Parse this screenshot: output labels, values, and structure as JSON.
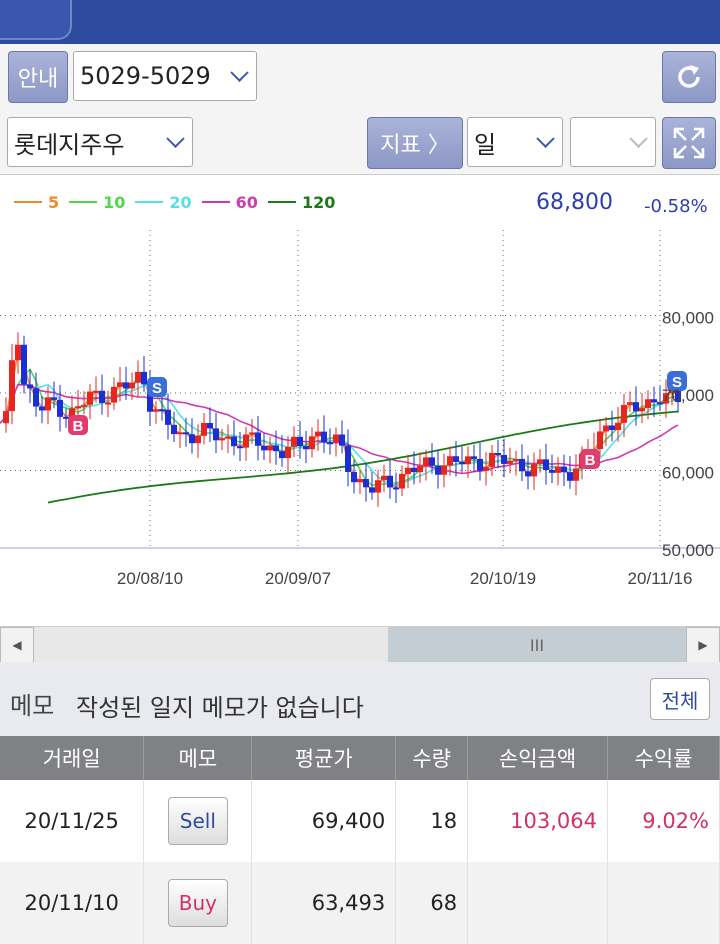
{
  "toolbar": {
    "guide_label": "안내",
    "account_value": "5029-5029",
    "stock_value": "롯데지주우",
    "indicator_label": "지표 〉",
    "period_value": "일",
    "extra_value": ""
  },
  "chart_header": {
    "legend": [
      {
        "label": "5",
        "color": "#ef8a2a"
      },
      {
        "label": "10",
        "color": "#4fd84a"
      },
      {
        "label": "20",
        "color": "#55e0e8"
      },
      {
        "label": "60",
        "color": "#d03ab0"
      },
      {
        "label": "120",
        "color": "#1c7a18"
      }
    ],
    "price": "68,800",
    "change": "-0.58%"
  },
  "chart_data": {
    "type": "candlestick",
    "x_tick_labels": [
      "20/08/10",
      "20/09/07",
      "20/10/19",
      "20/11/16"
    ],
    "y_tick_labels": [
      "80,000",
      "70,000",
      "60,000",
      "50,000"
    ],
    "ylim": [
      50000,
      90000
    ],
    "series": [
      {
        "name": "5",
        "color": "#ef8a2a"
      },
      {
        "name": "10",
        "color": "#4fd84a"
      },
      {
        "name": "20",
        "color": "#55e0e8"
      },
      {
        "name": "60",
        "color": "#d03ab0"
      },
      {
        "name": "120",
        "color": "#1c7a18"
      }
    ],
    "markers": [
      {
        "label": "B",
        "color": "#e23b6e"
      },
      {
        "label": "S",
        "color": "#3a6ed8"
      },
      {
        "label": "B",
        "color": "#e23b6e"
      },
      {
        "label": "S",
        "color": "#3a6ed8"
      }
    ],
    "grid": true
  },
  "scroll": {
    "left_arrow": "◀",
    "right_arrow": "▶",
    "thumb_label": "III"
  },
  "memo": {
    "label": "메모",
    "text": "작성된 일지 메모가 없습니다",
    "all_button": "전체"
  },
  "table": {
    "headers": [
      "거래일",
      "메모",
      "평균가",
      "수량",
      "손익금액",
      "수익률"
    ],
    "rows": [
      {
        "date": "20/11/25",
        "memo": "Sell",
        "avg_price": "69,400",
        "qty": "18",
        "pnl": "103,064",
        "rate": "9.02%"
      },
      {
        "date": "20/11/10",
        "memo": "Buy",
        "avg_price": "63,493",
        "qty": "68",
        "pnl": "",
        "rate": ""
      }
    ]
  },
  "colors": {
    "up": "#e8261f",
    "down": "#1a2fd8",
    "accent": "#2f4ba0"
  }
}
